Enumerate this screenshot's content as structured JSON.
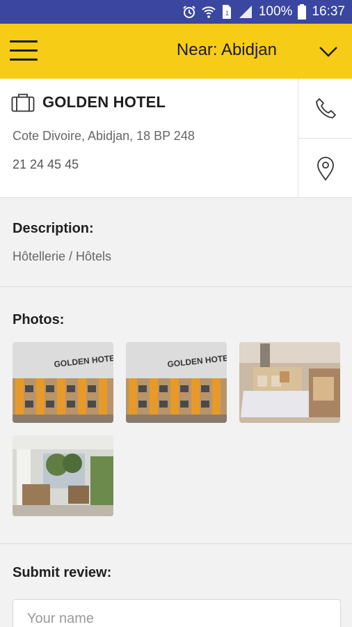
{
  "status_bar": {
    "battery": "100%",
    "time": "16:37",
    "icons": [
      "alarm-icon",
      "wifi-icon",
      "sim-icon",
      "signal-icon",
      "battery-icon"
    ]
  },
  "app_bar": {
    "menu_icon": "hamburger-menu-icon",
    "location": "Near: Abidjan",
    "dropdown_icon": "chevron-down-icon",
    "background_color": "#f6cc16"
  },
  "hotel": {
    "icon": "briefcase-icon",
    "name": "GOLDEN HOTEL",
    "address": "Cote Divoire, Abidjan, 18 BP 248",
    "phone": "21 24 45 45",
    "actions": [
      {
        "icon": "phone-icon"
      },
      {
        "icon": "map-pin-icon"
      }
    ]
  },
  "description": {
    "title": "Description:",
    "text": "Hôtellerie / Hôtels"
  },
  "photos": {
    "title": "Photos:",
    "items": [
      {
        "sign_text": "GOLDEN HOTEL",
        "kind": "facade"
      },
      {
        "sign_text": "GOLDEN HOTEL",
        "kind": "facade"
      },
      {
        "kind": "bedroom"
      },
      {
        "kind": "lounge"
      }
    ]
  },
  "review": {
    "title": "Submit review:",
    "name_placeholder": "Your name"
  }
}
